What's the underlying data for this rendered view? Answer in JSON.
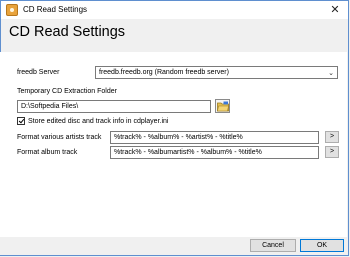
{
  "window": {
    "title": "CD Read Settings"
  },
  "page_title": "CD Read Settings",
  "freedb": {
    "label": "freedb Server",
    "selected": "freedb.freedb.org (Random freedb server)"
  },
  "temp_folder": {
    "label": "Temporary CD Extraction Folder",
    "value": "D:\\Softpedia Files\\"
  },
  "store_checkbox": {
    "label": "Store edited disc and track info in cdplayer.ini",
    "checked": true
  },
  "various_format": {
    "label": "Format various artists track",
    "value": "%track% - %album% - %artist% - %title%",
    "button": ">"
  },
  "album_format": {
    "label": "Format album track",
    "value": "%track% - %albumartist% - %album% - %title%",
    "button": ">"
  },
  "buttons": {
    "cancel": "Cancel",
    "ok": "OK"
  },
  "icons": {
    "app": "cd-app-icon",
    "close": "close-icon",
    "folder": "folder-browse-icon",
    "dropdown": "chevron-down-icon"
  }
}
